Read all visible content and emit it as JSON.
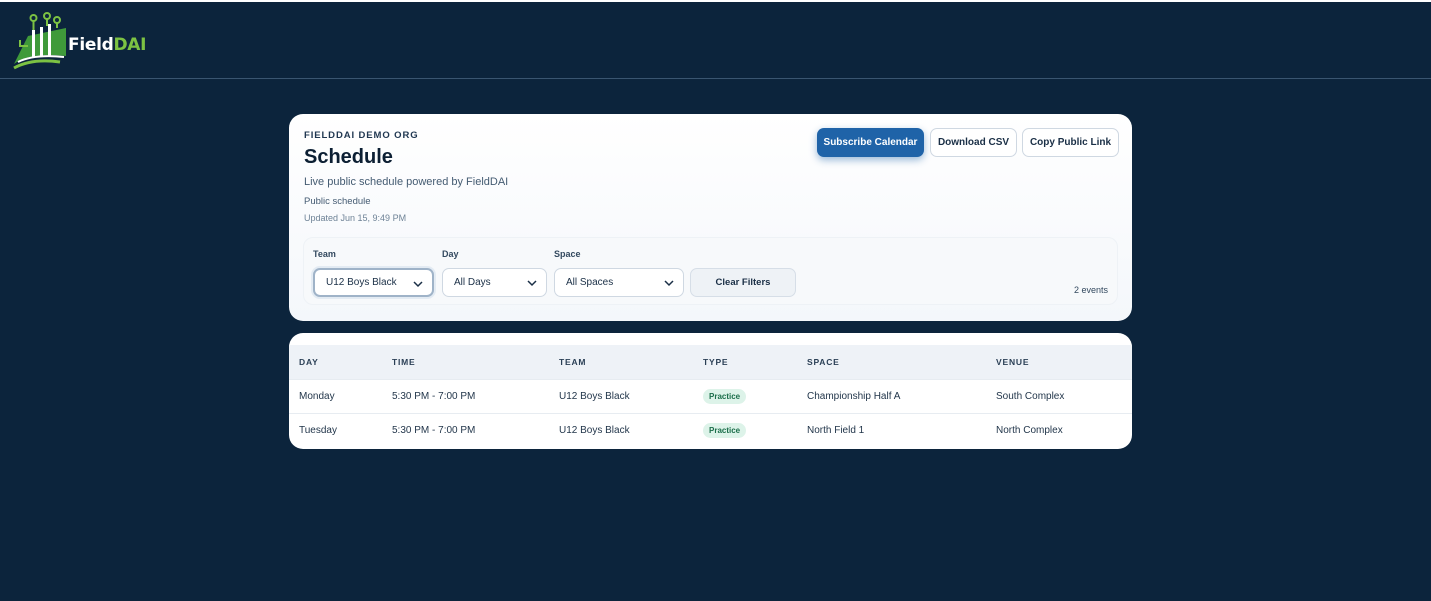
{
  "brand": {
    "name_main": "Field",
    "name_accent": "DAI"
  },
  "header": {
    "org": "FIELDDAI DEMO ORG",
    "title": "Schedule",
    "subtitle": "Live public schedule powered by FieldDAI",
    "visibility": "Public schedule",
    "updated": "Updated Jun 15, 9:49 PM"
  },
  "actions": {
    "subscribe": "Subscribe Calendar",
    "download_csv": "Download CSV",
    "copy_link": "Copy Public Link"
  },
  "filters": {
    "team_label": "Team",
    "team_value": "U12 Boys Black",
    "day_label": "Day",
    "day_value": "All Days",
    "space_label": "Space",
    "space_value": "All Spaces",
    "clear": "Clear Filters",
    "count": "2 events"
  },
  "table": {
    "headers": [
      "DAY",
      "TIME",
      "TEAM",
      "TYPE",
      "SPACE",
      "VENUE"
    ],
    "rows": [
      [
        "Monday",
        "5:30 PM - 7:00 PM",
        "U12 Boys Black",
        "Practice",
        "Championship Half A",
        "South Complex"
      ],
      [
        "Tuesday",
        "5:30 PM - 7:00 PM",
        "U12 Boys Black",
        "Practice",
        "North Field 1",
        "North Complex"
      ]
    ]
  },
  "colors": {
    "page_bg": "#0c243c",
    "primary": "#1f63a8",
    "brand_green": "#7cc243",
    "badge_bg": "#ddf3e9",
    "badge_text": "#1b6e4a"
  }
}
